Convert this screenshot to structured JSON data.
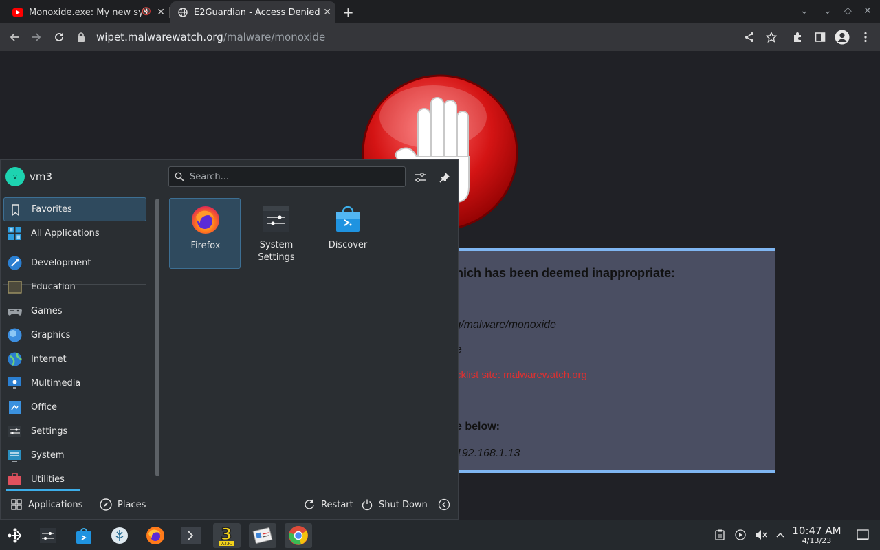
{
  "browser": {
    "tabs": [
      {
        "title": "Monoxide.exe: My new sy",
        "active": false
      },
      {
        "title": "E2Guardian - Access Denied",
        "active": true
      }
    ],
    "address_host": "wipet.malwarewatch.org",
    "address_path": "/malware/monoxide"
  },
  "blocked_page": {
    "heading": "hich has been deemed inappropriate:",
    "url_fragment": "rg/malware/monoxide",
    "line2": "e",
    "reason": "cklist site: malwarewatch.org",
    "prompt": "e below:",
    "ip": "192.168.1.13"
  },
  "launcher": {
    "user": {
      "initial": "v",
      "name": "vm3"
    },
    "search_placeholder": "Search...",
    "categories": [
      {
        "label": "Favorites",
        "icon": "bookmark-icon",
        "selected": true
      },
      {
        "label": "All Applications",
        "icon": "grid-icon"
      },
      {
        "label": "Development",
        "icon": "development-icon"
      },
      {
        "label": "Education",
        "icon": "education-icon"
      },
      {
        "label": "Games",
        "icon": "gamepad-icon"
      },
      {
        "label": "Graphics",
        "icon": "graphics-icon"
      },
      {
        "label": "Internet",
        "icon": "globe-icon"
      },
      {
        "label": "Multimedia",
        "icon": "multimedia-icon"
      },
      {
        "label": "Office",
        "icon": "office-icon"
      },
      {
        "label": "Settings",
        "icon": "settings-icon"
      },
      {
        "label": "System",
        "icon": "system-icon"
      },
      {
        "label": "Utilities",
        "icon": "utilities-icon"
      }
    ],
    "apps": [
      {
        "label": "Firefox",
        "icon": "firefox-icon",
        "selected": true
      },
      {
        "label": "System Settings",
        "icon": "system-settings-icon"
      },
      {
        "label": "Discover",
        "icon": "discover-icon"
      }
    ],
    "footer": {
      "applications": "Applications",
      "places": "Places",
      "restart": "Restart",
      "shutdown": "Shut Down"
    }
  },
  "taskbar": {
    "time": "10:47 AM",
    "date": "4/13/23"
  },
  "colors": {
    "accent": "#3daee9",
    "selected_bg": "#2f4a5e",
    "panel_border": "#7fb6f2",
    "error_red": "#e03030"
  }
}
